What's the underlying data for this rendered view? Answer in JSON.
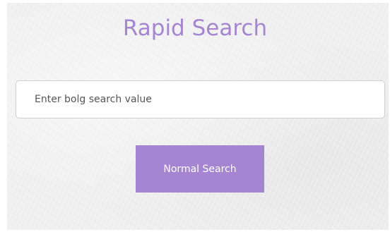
{
  "header": {
    "title": "Rapid Search"
  },
  "search": {
    "placeholder": "Enter bolg search value",
    "value": ""
  },
  "actions": {
    "normal_search_label": "Normal Search"
  },
  "colors": {
    "accent": "#a585d2",
    "button_text": "#ffffff",
    "input_border": "#cfcfcf",
    "background": "#efefef"
  }
}
